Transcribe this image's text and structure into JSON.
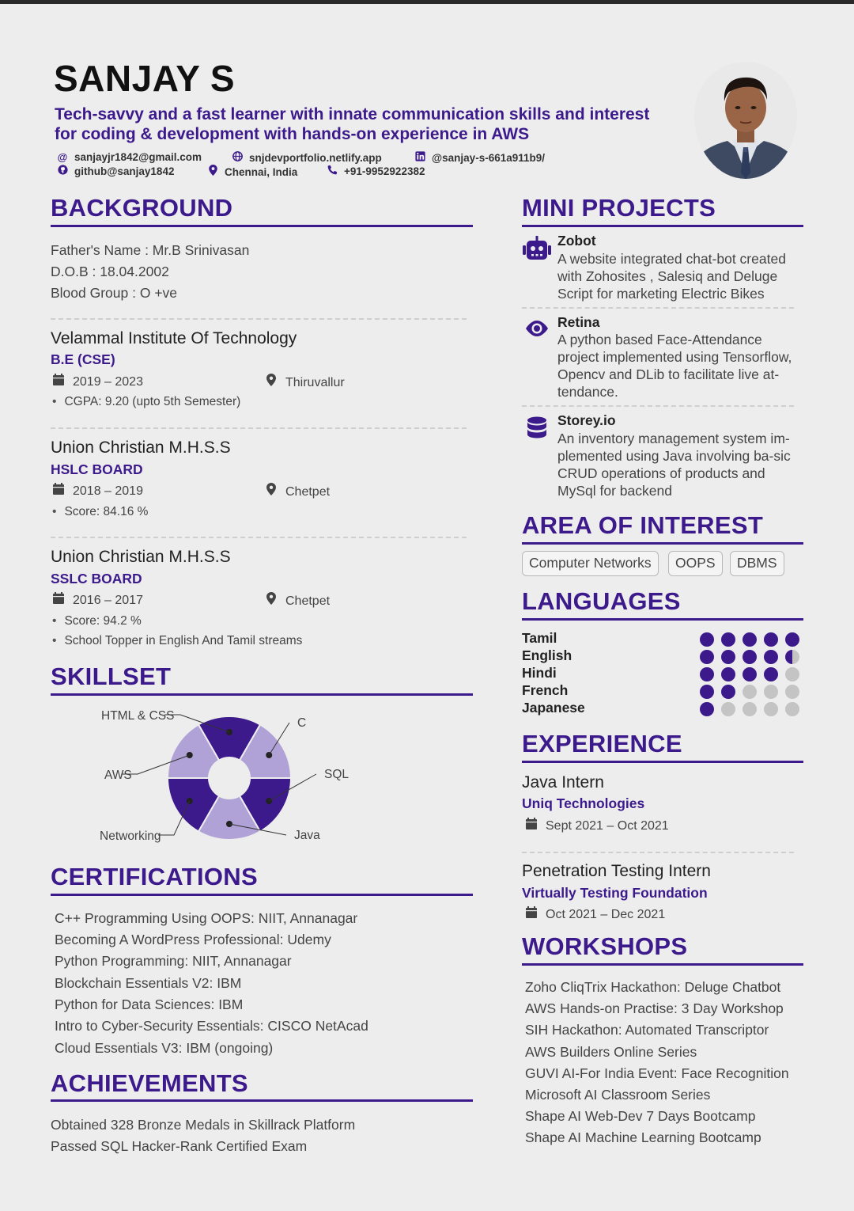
{
  "header": {
    "name": "SANJAY S",
    "tagline": "Tech-savvy and a fast learner with innate communication skills and interest for coding & development with hands-on experience in AWS",
    "email": "sanjayjr1842@gmail.com",
    "portfolio": "snjdevportfolio.netlify.app",
    "linkedin": "@sanjay-s-661a911b9/",
    "github": "github@sanjay1842",
    "location": "Chennai, India",
    "phone": "+91-9952922382"
  },
  "background": {
    "title": "BACKGROUND",
    "father": "Father's Name : Mr.B Srinivasan",
    "dob": "D.O.B : 18.04.2002",
    "blood": "Blood Group : O +ve",
    "education": [
      {
        "institution": "Velammal Institute Of Technology",
        "degree": "B.E (CSE)",
        "years": "2019 – 2023",
        "place": "Thiruvallur",
        "bullets": [
          "CGPA: 9.20 (upto 5th Semester)"
        ]
      },
      {
        "institution": "Union Christian M.H.S.S",
        "degree": "HSLC BOARD",
        "years": "2018 – 2019",
        "place": "Chetpet",
        "bullets": [
          "Score: 84.16 %"
        ]
      },
      {
        "institution": "Union Christian M.H.S.S",
        "degree": "SSLC BOARD",
        "years": "2016 – 2017",
        "place": "Chetpet",
        "bullets": [
          "Score: 94.2 %",
          "School Topper in English And Tamil streams"
        ]
      }
    ]
  },
  "skillset": {
    "title": "SKILLSET"
  },
  "chart_data": {
    "type": "pie",
    "categories": [
      "HTML & CSS",
      "C",
      "SQL",
      "Java",
      "Networking",
      "AWS"
    ],
    "values": [
      1,
      1,
      1,
      1,
      1,
      1
    ],
    "colors": [
      "#3c1a8c",
      "#b0a2d6",
      "#3c1a8c",
      "#b0a2d6",
      "#3c1a8c",
      "#b0a2d6"
    ]
  },
  "certifications": {
    "title": "CERTIFICATIONS",
    "items": [
      "C++ Programming Using OOPS: NIIT, Annanagar",
      "Becoming A WordPress Professional: Udemy",
      "Python Programming: NIIT, Annanagar",
      "Blockchain Essentials V2: IBM",
      "Python for Data Sciences: IBM",
      "Intro to Cyber-Security Essentials: CISCO NetAcad",
      "Cloud Essentials V3: IBM (ongoing)"
    ]
  },
  "achievements": {
    "title": "ACHIEVEMENTS",
    "items": [
      "Obtained 328 Bronze Medals in Skillrack Platform",
      "Passed SQL Hacker-Rank Certified Exam"
    ]
  },
  "projects": {
    "title": "MINI PROJECTS",
    "items": [
      {
        "name": "Zobot",
        "icon": "robot-icon",
        "desc": "A website integrated chat-bot created with Zohosites , Salesiq and Deluge Script for marketing Electric Bikes"
      },
      {
        "name": "Retina",
        "icon": "eye-icon",
        "desc": "A python based Face-Attendance project implemented using Tensorflow, Opencv and DLib to facilitate live at-tendance."
      },
      {
        "name": "Storey.io",
        "icon": "database-icon",
        "desc": "An inventory management system im-plemented using Java involving ba-sic CRUD operations of products and MySql for backend"
      }
    ]
  },
  "interest": {
    "title": "AREA OF INTEREST",
    "tags": [
      "Computer Networks",
      "OOPS",
      "DBMS"
    ]
  },
  "languages": {
    "title": "LANGUAGES",
    "items": [
      {
        "name": "Tamil",
        "level": 5
      },
      {
        "name": "English",
        "level": 4.5
      },
      {
        "name": "Hindi",
        "level": 4
      },
      {
        "name": "French",
        "level": 2
      },
      {
        "name": "Japanese",
        "level": 1
      }
    ],
    "max": 5
  },
  "experience": {
    "title": "EXPERIENCE",
    "items": [
      {
        "role": "Java Intern",
        "company": "Uniq Technologies",
        "dates": "Sept 2021 – Oct 2021"
      },
      {
        "role": "Penetration Testing Intern",
        "company": "Virtually Testing Foundation",
        "dates": "Oct 2021 – Dec 2021"
      }
    ]
  },
  "workshops": {
    "title": "WORKSHOPS",
    "items": [
      "Zoho CliqTrix Hackathon: Deluge Chatbot",
      "AWS Hands-on Practise: 3 Day Workshop",
      "SIH Hackathon: Automated Transcriptor",
      "AWS Builders Online Series",
      "GUVI AI-For India Event: Face Recognition",
      "Microsoft AI Classroom Series",
      "Shape AI Web-Dev 7 Days Bootcamp",
      "Shape AI Machine Learning Bootcamp"
    ]
  }
}
